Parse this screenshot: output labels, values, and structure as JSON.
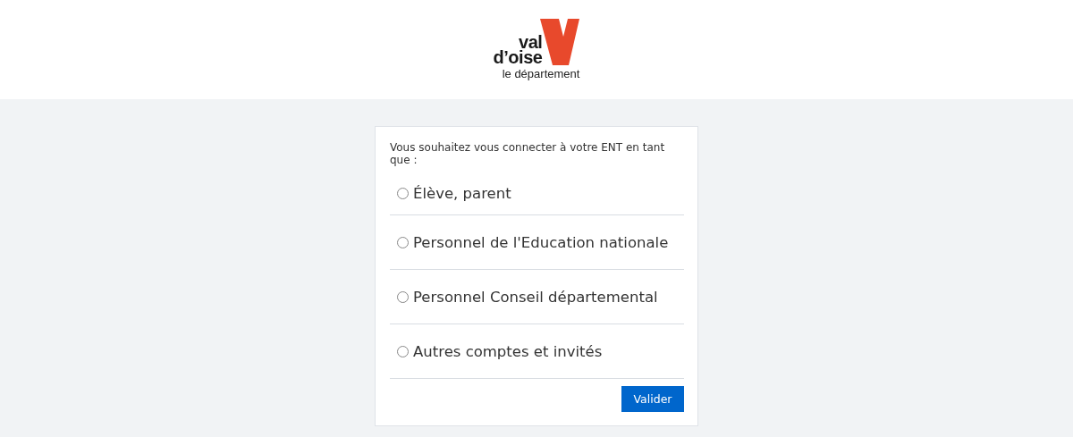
{
  "logo": {
    "line_1": "val",
    "line_2": "d’oise",
    "tagline": "le département"
  },
  "form": {
    "prompt": "Vous souhaitez vous connecter à votre ENT en tant que :",
    "options": [
      {
        "label": "Élève, parent",
        "selected": false
      },
      {
        "label": "Personnel de l'Education nationale",
        "selected": false
      },
      {
        "label": "Personnel Conseil départemental",
        "selected": false
      },
      {
        "label": "Autres comptes et invités",
        "selected": false
      }
    ],
    "submit": "Valider"
  }
}
